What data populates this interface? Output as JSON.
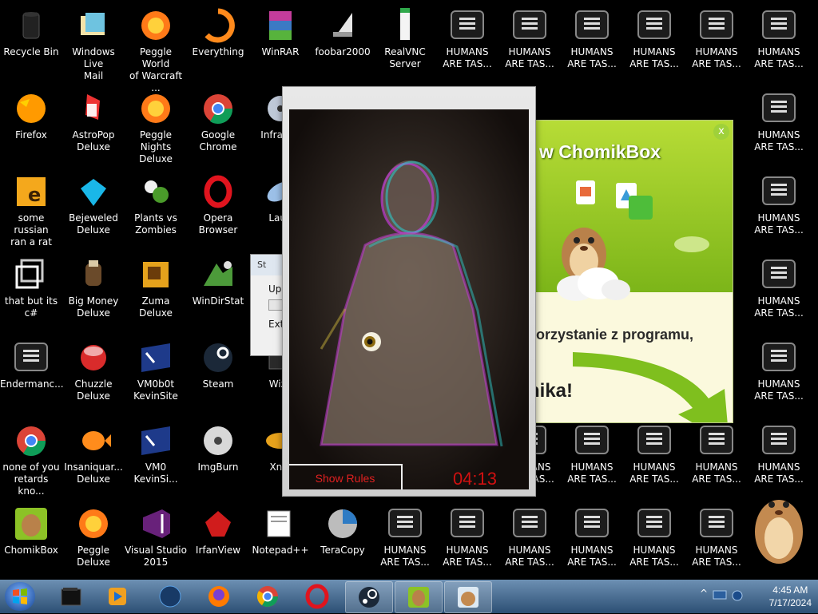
{
  "desktop": {
    "icons": [
      {
        "name": "recycle-bin-icon",
        "label": "Recycle Bin",
        "col": 0,
        "row": 0,
        "kind": "bin"
      },
      {
        "name": "windows-live-mail-icon",
        "label": "Windows Live\nMail",
        "col": 1,
        "row": 0,
        "kind": "mail"
      },
      {
        "name": "peggle-world-icon",
        "label": "Peggle World\nof Warcraft ...",
        "col": 2,
        "row": 0,
        "kind": "peggle"
      },
      {
        "name": "everything-icon",
        "label": "Everything",
        "col": 3,
        "row": 0,
        "kind": "search"
      },
      {
        "name": "winrar-icon",
        "label": "WinRAR",
        "col": 4,
        "row": 0,
        "kind": "winrar"
      },
      {
        "name": "foobar-icon",
        "label": "foobar2000",
        "col": 5,
        "row": 0,
        "kind": "foobar"
      },
      {
        "name": "realvnc-icon",
        "label": "RealVNC\nServer",
        "col": 6,
        "row": 0,
        "kind": "vnc"
      },
      {
        "name": "humans-icon",
        "label": "HUMANS\nARE TAS...",
        "col": 7,
        "row": 0,
        "kind": "humans"
      },
      {
        "name": "humans-icon",
        "label": "HUMANS\nARE TAS...",
        "col": 8,
        "row": 0,
        "kind": "humans"
      },
      {
        "name": "humans-icon",
        "label": "HUMANS\nARE TAS...",
        "col": 9,
        "row": 0,
        "kind": "humans"
      },
      {
        "name": "humans-icon",
        "label": "HUMANS\nARE TAS...",
        "col": 10,
        "row": 0,
        "kind": "humans"
      },
      {
        "name": "humans-icon",
        "label": "HUMANS\nARE TAS...",
        "col": 11,
        "row": 0,
        "kind": "humans"
      },
      {
        "name": "humans-icon",
        "label": "HUMANS\nARE TAS...",
        "col": 12,
        "row": 0,
        "kind": "humans"
      },
      {
        "name": "firefox-icon",
        "label": "Firefox",
        "col": 0,
        "row": 1,
        "kind": "firefox"
      },
      {
        "name": "astropop-icon",
        "label": "AstroPop\nDeluxe",
        "col": 1,
        "row": 1,
        "kind": "astro"
      },
      {
        "name": "peggle-nights-icon",
        "label": "Peggle Nights\nDeluxe",
        "col": 2,
        "row": 1,
        "kind": "peggle"
      },
      {
        "name": "google-chrome-icon",
        "label": "Google\nChrome",
        "col": 3,
        "row": 1,
        "kind": "chrome"
      },
      {
        "name": "infrarecorder-icon",
        "label": "InfraRec",
        "col": 4,
        "row": 1,
        "kind": "infra"
      },
      {
        "name": "humans-icon",
        "label": "HUMANS\nARE TAS...",
        "col": 12,
        "row": 1,
        "kind": "humans"
      },
      {
        "name": "some-russian-icon",
        "label": "some russian\nran a rat",
        "col": 0,
        "row": 2,
        "kind": "russian"
      },
      {
        "name": "bejeweled-icon",
        "label": "Bejeweled\nDeluxe",
        "col": 1,
        "row": 2,
        "kind": "gem"
      },
      {
        "name": "plants-vs-zombies-icon",
        "label": "Plants vs\nZombies",
        "col": 2,
        "row": 2,
        "kind": "plant"
      },
      {
        "name": "opera-browser-icon",
        "label": "Opera\nBrowser",
        "col": 3,
        "row": 2,
        "kind": "opera"
      },
      {
        "name": "launcher-icon",
        "label": "Laun",
        "col": 4,
        "row": 2,
        "kind": "launch"
      },
      {
        "name": "humans-icon",
        "label": "HUMANS\nARE TAS...",
        "col": 12,
        "row": 2,
        "kind": "humans"
      },
      {
        "name": "that-but-its-csharp-icon",
        "label": "that but its c#",
        "col": 0,
        "row": 3,
        "kind": "copy"
      },
      {
        "name": "big-money-icon",
        "label": "Big Money\nDeluxe",
        "col": 1,
        "row": 3,
        "kind": "money"
      },
      {
        "name": "zuma-icon",
        "label": "Zuma Deluxe",
        "col": 2,
        "row": 3,
        "kind": "zuma"
      },
      {
        "name": "windirstat-icon",
        "label": "WinDirStat",
        "col": 3,
        "row": 3,
        "kind": "windir"
      },
      {
        "name": "humans-icon",
        "label": "HUMANS\nARE TAS...",
        "col": 12,
        "row": 3,
        "kind": "humans"
      },
      {
        "name": "endermanch-icon",
        "label": "Endermanc...",
        "col": 0,
        "row": 4,
        "kind": "humans"
      },
      {
        "name": "chuzzle-icon",
        "label": "Chuzzle\nDeluxe",
        "col": 1,
        "row": 4,
        "kind": "chuzzle"
      },
      {
        "name": "vm0b0t-icon",
        "label": "VM0b0t\nKevinSite",
        "col": 2,
        "row": 4,
        "kind": "vm"
      },
      {
        "name": "steam-icon",
        "label": "Steam",
        "col": 3,
        "row": 4,
        "kind": "steam"
      },
      {
        "name": "wiz-icon",
        "label": "WizT",
        "col": 4,
        "row": 4,
        "kind": "wiz"
      },
      {
        "name": "humans-icon",
        "label": "HUMANS\nARE TAS...",
        "col": 12,
        "row": 4,
        "kind": "humans"
      },
      {
        "name": "none-of-you-icon",
        "label": "none of you\nretards kno...",
        "col": 0,
        "row": 5,
        "kind": "chrome"
      },
      {
        "name": "insaniquarium-icon",
        "label": "Insaniquar...\nDeluxe",
        "col": 1,
        "row": 5,
        "kind": "fish"
      },
      {
        "name": "vm0-kevinsite-icon",
        "label": "VM0\nKevinSi...",
        "col": 2,
        "row": 5,
        "kind": "vm"
      },
      {
        "name": "imgburn-icon",
        "label": "ImgBurn",
        "col": 3,
        "row": 5,
        "kind": "imgburn"
      },
      {
        "name": "xnview-icon",
        "label": "XnVi",
        "col": 4,
        "row": 5,
        "kind": "xnview"
      },
      {
        "name": "humans-icon",
        "label": "HUMANS\nARE TAS...",
        "col": 8,
        "row": 5,
        "kind": "humans"
      },
      {
        "name": "humans-icon",
        "label": "HUMANS\nARE TAS...",
        "col": 9,
        "row": 5,
        "kind": "humans"
      },
      {
        "name": "humans-icon",
        "label": "HUMANS\nARE TAS...",
        "col": 10,
        "row": 5,
        "kind": "humans"
      },
      {
        "name": "humans-icon",
        "label": "HUMANS\nARE TAS...",
        "col": 11,
        "row": 5,
        "kind": "humans"
      },
      {
        "name": "humans-icon",
        "label": "HUMANS\nARE TAS...",
        "col": 12,
        "row": 5,
        "kind": "humans"
      },
      {
        "name": "chomikbox-icon",
        "label": "ChomikBox",
        "col": 0,
        "row": 6,
        "kind": "chomik"
      },
      {
        "name": "peggle-deluxe-icon",
        "label": "Peggle Deluxe",
        "col": 1,
        "row": 6,
        "kind": "peggle"
      },
      {
        "name": "visual-studio-icon",
        "label": "Visual Studio\n2015",
        "col": 2,
        "row": 6,
        "kind": "vs"
      },
      {
        "name": "irfanview-icon",
        "label": "IrfanView",
        "col": 3,
        "row": 6,
        "kind": "irfan"
      },
      {
        "name": "notepadpp-icon",
        "label": "Notepad++",
        "col": 4,
        "row": 6,
        "kind": "notepad"
      },
      {
        "name": "teracopy-icon",
        "label": "TeraCopy",
        "col": 5,
        "row": 6,
        "kind": "teracopy"
      },
      {
        "name": "humans-icon",
        "label": "HUMANS\nARE TAS...",
        "col": 6,
        "row": 6,
        "kind": "humans"
      },
      {
        "name": "humans-icon",
        "label": "HUMANS\nARE TAS...",
        "col": 7,
        "row": 6,
        "kind": "humans"
      },
      {
        "name": "humans-icon",
        "label": "HUMANS\nARE TAS...",
        "col": 8,
        "row": 6,
        "kind": "humans"
      },
      {
        "name": "humans-icon",
        "label": "HUMANS\nARE TAS...",
        "col": 9,
        "row": 6,
        "kind": "humans"
      },
      {
        "name": "humans-icon",
        "label": "HUMANS\nARE TAS...",
        "col": 10,
        "row": 6,
        "kind": "humans"
      },
      {
        "name": "humans-icon",
        "label": "HUMANS\nARE TAS...",
        "col": 11,
        "row": 6,
        "kind": "humans"
      }
    ]
  },
  "scary_window": {
    "show_rules_label": "Show Rules",
    "timer": "04:13"
  },
  "st_dialog": {
    "title": "St",
    "row1": "Upc",
    "row2": "Ext"
  },
  "chomikbox_popup": {
    "title": "w ChomikBox",
    "close_label": "x",
    "line1": "korzystanie z programu,",
    "line2": "nika!"
  },
  "taskbar": {
    "pinned": [
      "file-explorer-icon",
      "media-player-icon",
      "globe-icon",
      "firefox-icon",
      "chrome-icon",
      "opera-icon"
    ],
    "running": [
      "steam-icon",
      "chomikbox-icon",
      "hamster-icon"
    ],
    "tray_chevron": "^"
  },
  "clock": {
    "time": "4:45 AM",
    "date": "7/17/2024"
  },
  "colors": {
    "taskbar": "#3d6289",
    "chomik_green": "#8cc226",
    "timer_red": "#d01010"
  }
}
